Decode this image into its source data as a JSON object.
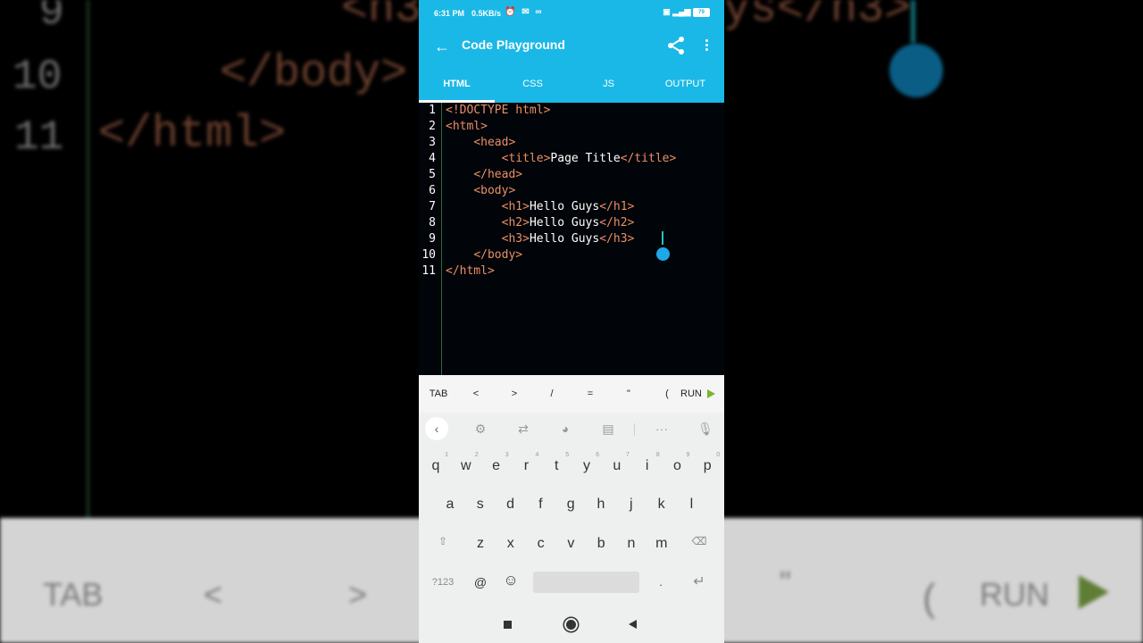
{
  "background": {
    "line_numbers": [
      "9",
      "10",
      "11"
    ],
    "code_lines": [
      "<h3",
      "ys</h3>",
      "</body>",
      "</html>"
    ],
    "bottom_bar": [
      "TAB",
      "<",
      ">",
      "\"",
      "(",
      "RUN"
    ]
  },
  "status_bar": {
    "time": "6:31 PM",
    "speed": "0.5KB/s",
    "battery": "79"
  },
  "app_bar": {
    "title": "Code Playground",
    "back_icon": "arrow-left-icon",
    "share_icon": "share-icon",
    "more_icon": "more-vert-icon"
  },
  "tabs": [
    {
      "label": "HTML",
      "active": true
    },
    {
      "label": "CSS",
      "active": false
    },
    {
      "label": "JS",
      "active": false
    },
    {
      "label": "OUTPUT",
      "active": false
    }
  ],
  "editor": {
    "lines": [
      {
        "n": "1",
        "indent": "",
        "parts": [
          {
            "t": "<!DOCTYPE html>",
            "k": "tag"
          }
        ]
      },
      {
        "n": "2",
        "indent": "",
        "parts": [
          {
            "t": "<html>",
            "k": "tag"
          }
        ]
      },
      {
        "n": "3",
        "indent": "    ",
        "parts": [
          {
            "t": "<head>",
            "k": "tag"
          }
        ]
      },
      {
        "n": "4",
        "indent": "        ",
        "parts": [
          {
            "t": "<title>",
            "k": "tag"
          },
          {
            "t": "Page Title",
            "k": "txt"
          },
          {
            "t": "</title>",
            "k": "tag"
          }
        ]
      },
      {
        "n": "5",
        "indent": "    ",
        "parts": [
          {
            "t": "</head>",
            "k": "tag"
          }
        ]
      },
      {
        "n": "6",
        "indent": "    ",
        "parts": [
          {
            "t": "<body>",
            "k": "tag"
          }
        ]
      },
      {
        "n": "7",
        "indent": "        ",
        "parts": [
          {
            "t": "<h1>",
            "k": "tag"
          },
          {
            "t": "Hello Guys",
            "k": "txt"
          },
          {
            "t": "</h1>",
            "k": "tag"
          }
        ]
      },
      {
        "n": "8",
        "indent": "        ",
        "parts": [
          {
            "t": "<h2>",
            "k": "tag"
          },
          {
            "t": "Hello Guys",
            "k": "txt"
          },
          {
            "t": "</h2>",
            "k": "tag"
          }
        ]
      },
      {
        "n": "9",
        "indent": "        ",
        "parts": [
          {
            "t": "<h3>",
            "k": "tag"
          },
          {
            "t": "Hello Guys",
            "k": "txt"
          },
          {
            "t": "</h3>",
            "k": "tag"
          }
        ]
      },
      {
        "n": "10",
        "indent": "    ",
        "parts": [
          {
            "t": "</body>",
            "k": "tag"
          }
        ]
      },
      {
        "n": "11",
        "indent": "",
        "parts": [
          {
            "t": "</html>",
            "k": "tag"
          }
        ]
      }
    ]
  },
  "symbol_bar": {
    "keys": [
      "TAB",
      "<",
      ">",
      "/",
      "=",
      "\"",
      "("
    ],
    "run_label": "RUN"
  },
  "keyboard": {
    "tools": [
      "settings-icon",
      "translate-icon",
      "palette-icon",
      "clipboard-icon",
      "more-horiz-icon",
      "mic-off-icon"
    ],
    "row1": [
      {
        "k": "q",
        "h": "1"
      },
      {
        "k": "w",
        "h": "2"
      },
      {
        "k": "e",
        "h": "3"
      },
      {
        "k": "r",
        "h": "4"
      },
      {
        "k": "t",
        "h": "5"
      },
      {
        "k": "y",
        "h": "6"
      },
      {
        "k": "u",
        "h": "7"
      },
      {
        "k": "i",
        "h": "8"
      },
      {
        "k": "o",
        "h": "9"
      },
      {
        "k": "p",
        "h": "0"
      }
    ],
    "row2": [
      "a",
      "s",
      "d",
      "f",
      "g",
      "h",
      "j",
      "k",
      "l"
    ],
    "row3": [
      "z",
      "x",
      "c",
      "v",
      "b",
      "n",
      "m"
    ],
    "symbols_key": "?123",
    "at_key": "@",
    "period_key": "."
  },
  "colors": {
    "accent": "#1ab8e6",
    "editor_bg": "#010409",
    "tag": "#ec8f64",
    "run_arrow": "#78b52c"
  }
}
